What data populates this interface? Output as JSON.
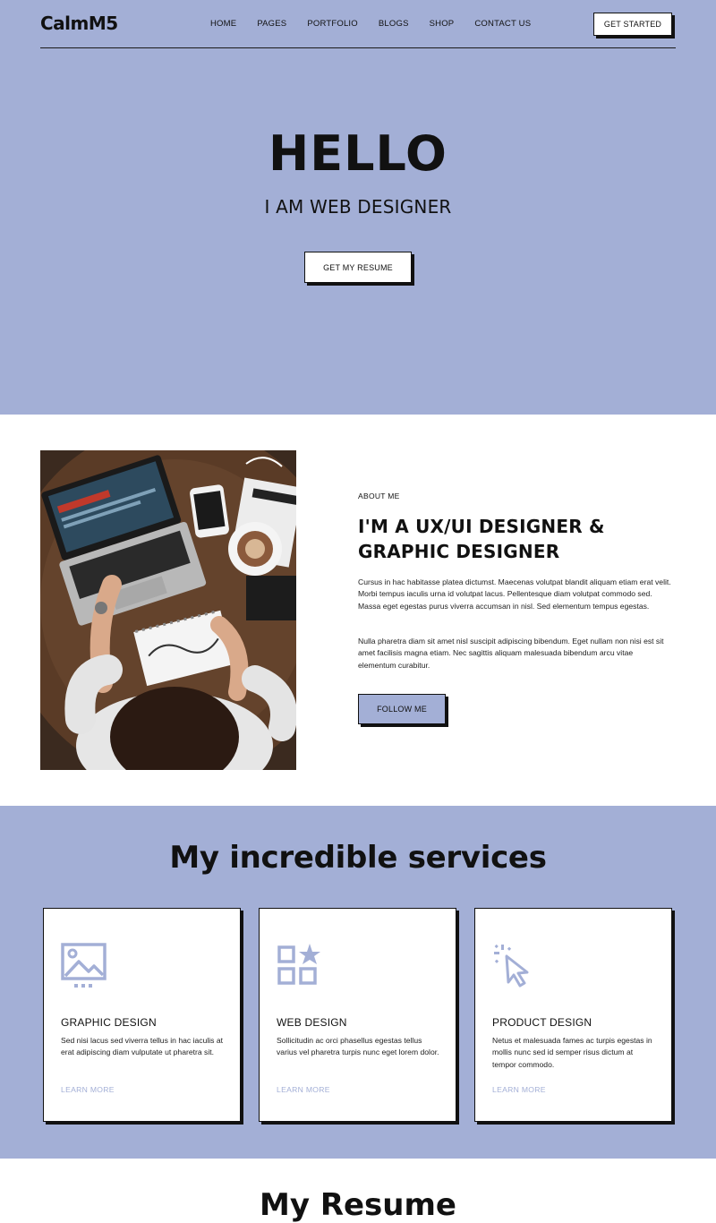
{
  "nav": {
    "logo": "CalmM5",
    "items": [
      "HOME",
      "PAGES",
      "PORTFOLIO",
      "BLOGS",
      "SHOP",
      "CONTACT US"
    ],
    "cta": "GET STARTED"
  },
  "hero": {
    "title": "HELLO",
    "subtitle": "I AM WEB DESIGNER",
    "button": "GET MY RESUME"
  },
  "about": {
    "label": "ABOUT ME",
    "heading": "I'M A UX/UI DESIGNER & GRAPHIC DESIGNER",
    "paragraph1": "Cursus in hac habitasse platea dictumst. Maecenas volutpat blandit aliquam etiam erat velit. Morbi tempus iaculis urna id volutpat lacus. Pellentesque diam volutpat commodo sed. Massa eget egestas purus viverra accumsan in nisl. Sed elementum tempus egestas.",
    "paragraph2": "Nulla pharetra diam sit amet nisl suscipit adipiscing bibendum. Eget nullam non nisi est sit amet facilisis magna etiam. Nec sagittis aliquam malesuada bibendum arcu vitae elementum curabitur.",
    "button": "FOLLOW ME"
  },
  "services": {
    "title": "My incredible services",
    "cards": [
      {
        "icon": "image-icon",
        "title": "GRAPHIC DESIGN",
        "text": "Sed nisi lacus sed viverra tellus in hac iaculis at erat adipiscing diam vulputate ut pharetra sit.",
        "link": "LEARN MORE"
      },
      {
        "icon": "grid-star-icon",
        "title": "WEB DESIGN",
        "text": "Sollicitudin ac orci phasellus egestas tellus varius vel pharetra turpis nunc eget lorem dolor.",
        "link": "LEARN MORE"
      },
      {
        "icon": "cursor-click-icon",
        "title": "PRODUCT DESIGN",
        "text": "Netus et malesuada fames ac turpis egestas in mollis nunc sed id semper risus dictum at tempor commodo.",
        "link": "LEARN MORE"
      }
    ]
  },
  "resume": {
    "title": "My Resume"
  },
  "colors": {
    "accent": "#a3afd6",
    "ink": "#111111",
    "white": "#ffffff"
  }
}
